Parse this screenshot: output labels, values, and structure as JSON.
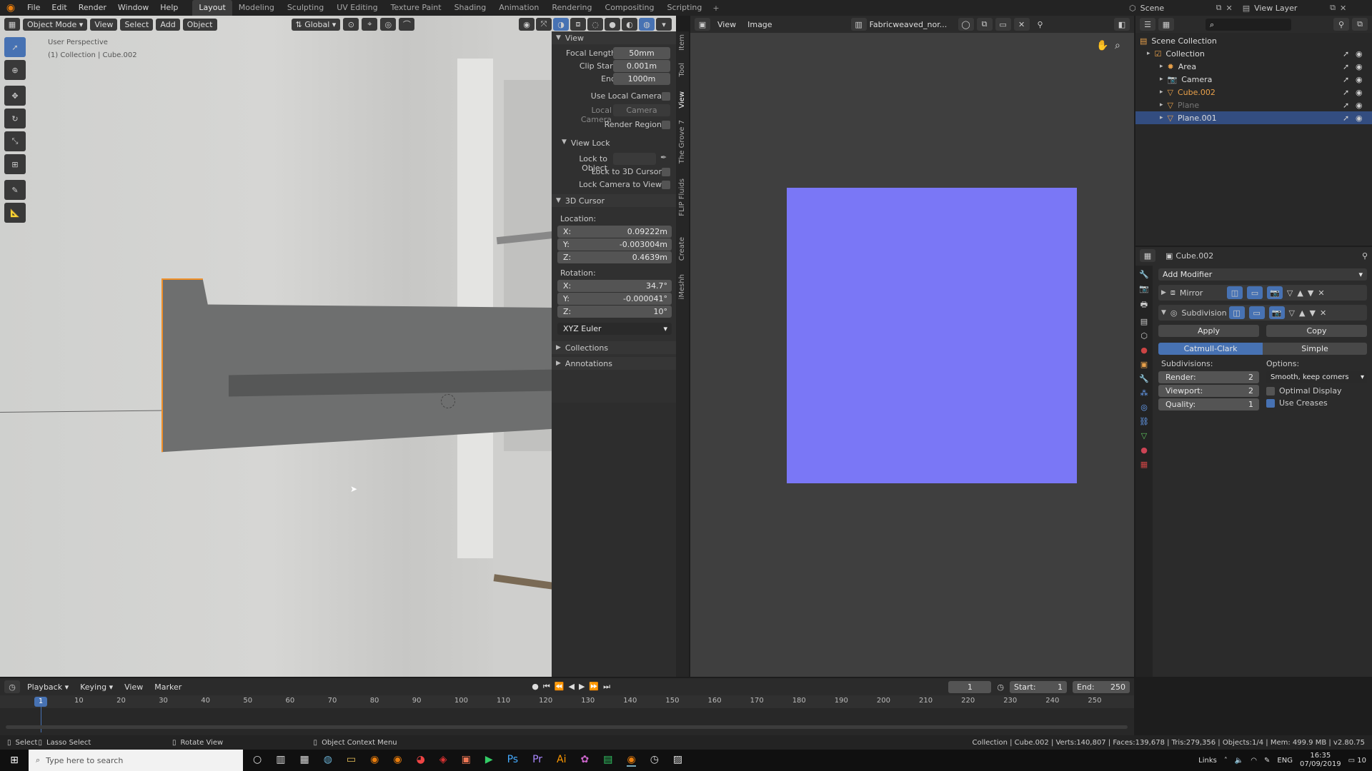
{
  "top_menu": {
    "items": [
      "File",
      "Edit",
      "Render",
      "Window",
      "Help"
    ]
  },
  "workspaces": [
    "Layout",
    "Modeling",
    "Sculpting",
    "UV Editing",
    "Texture Paint",
    "Shading",
    "Animation",
    "Rendering",
    "Compositing",
    "Scripting"
  ],
  "scene_label": "Scene",
  "view_layer_label": "View Layer",
  "viewport": {
    "mode": "Object Mode",
    "menus": [
      "View",
      "Select",
      "Add",
      "Object"
    ],
    "transform": "Global",
    "perspective": "User Perspective",
    "collection_info": "(1) Collection | Cube.002"
  },
  "npanel": {
    "tabs": [
      "Item",
      "Tool",
      "View",
      "The Grove 7",
      "FLIP Fluids",
      "Create",
      "iMeshh"
    ],
    "view_header": "View",
    "focal_label": "Focal Length",
    "focal": "50mm",
    "clip_start_label": "Clip Start",
    "clip_start": "0.001m",
    "end_label": "End",
    "end": "1000m",
    "use_local_camera": "Use Local Camera",
    "local_camera_label": "Local Camera",
    "local_camera": "Camera",
    "render_region": "Render Region",
    "view_lock": "View Lock",
    "lock_to_object": "Lock to Object",
    "lock_3d_cursor": "Lock to 3D Cursor",
    "lock_camera": "Lock Camera to View",
    "cursor_header": "3D Cursor",
    "location": "Location:",
    "loc_x": "0.09222m",
    "loc_y": "-0.003004m",
    "loc_z": "0.4639m",
    "rotation": "Rotation:",
    "rot_x": "34.7°",
    "rot_y": "-0.000041°",
    "rot_z": "10°",
    "rot_mode": "XYZ Euler",
    "collections": "Collections",
    "annotations": "Annotations"
  },
  "image_editor": {
    "menus": [
      "View",
      "Image"
    ],
    "image_name": "Fabricweaved_nor..."
  },
  "outliner": {
    "scene_collection": "Scene Collection",
    "items": [
      {
        "name": "Collection"
      },
      {
        "name": "Area"
      },
      {
        "name": "Camera"
      },
      {
        "name": "Cube.002"
      },
      {
        "name": "Plane"
      },
      {
        "name": "Plane.001"
      }
    ]
  },
  "properties": {
    "object": "Cube.002",
    "add_modifier": "Add Modifier",
    "mod1": "Mirror",
    "mod2": "Subdivision",
    "apply": "Apply",
    "copy": "Copy",
    "catmull": "Catmull-Clark",
    "simple": "Simple",
    "subdivisions": "Subdivisions:",
    "options": "Options:",
    "render_label": "Render:",
    "render_val": "2",
    "viewport_label": "Viewport:",
    "viewport_val": "2",
    "quality_label": "Quality:",
    "quality_val": "1",
    "uv_smooth": "Smooth, keep corners",
    "optimal": "Optimal Display",
    "use_creases": "Use Creases"
  },
  "timeline": {
    "menus": [
      "Playback",
      "Keying",
      "View",
      "Marker"
    ],
    "current": "1",
    "start_label": "Start:",
    "start": "1",
    "end_label": "End:",
    "end": "250",
    "ticks": [
      "10",
      "20",
      "30",
      "40",
      "50",
      "60",
      "70",
      "80",
      "90",
      "100",
      "110",
      "120",
      "130",
      "140",
      "150",
      "160",
      "170",
      "180",
      "190",
      "200",
      "210",
      "220",
      "230",
      "240",
      "250"
    ]
  },
  "statusbar": {
    "select": "Select",
    "lasso": "Lasso Select",
    "rotate": "Rotate View",
    "context": "Object Context Menu",
    "info": "Collection | Cube.002 | Verts:140,807 | Faces:139,678 | Tris:279,356 | Objects:1/4 | Mem: 499.9 MB | v2.80.75"
  },
  "taskbar": {
    "search_placeholder": "Type here to search",
    "links": "Links",
    "lang": "ENG",
    "time": "16:35",
    "date": "07/09/2019",
    "notif": "10"
  },
  "colors": {
    "accent": "#4772b3",
    "normal_map": "#7a77f6",
    "selection": "#f0902a"
  }
}
